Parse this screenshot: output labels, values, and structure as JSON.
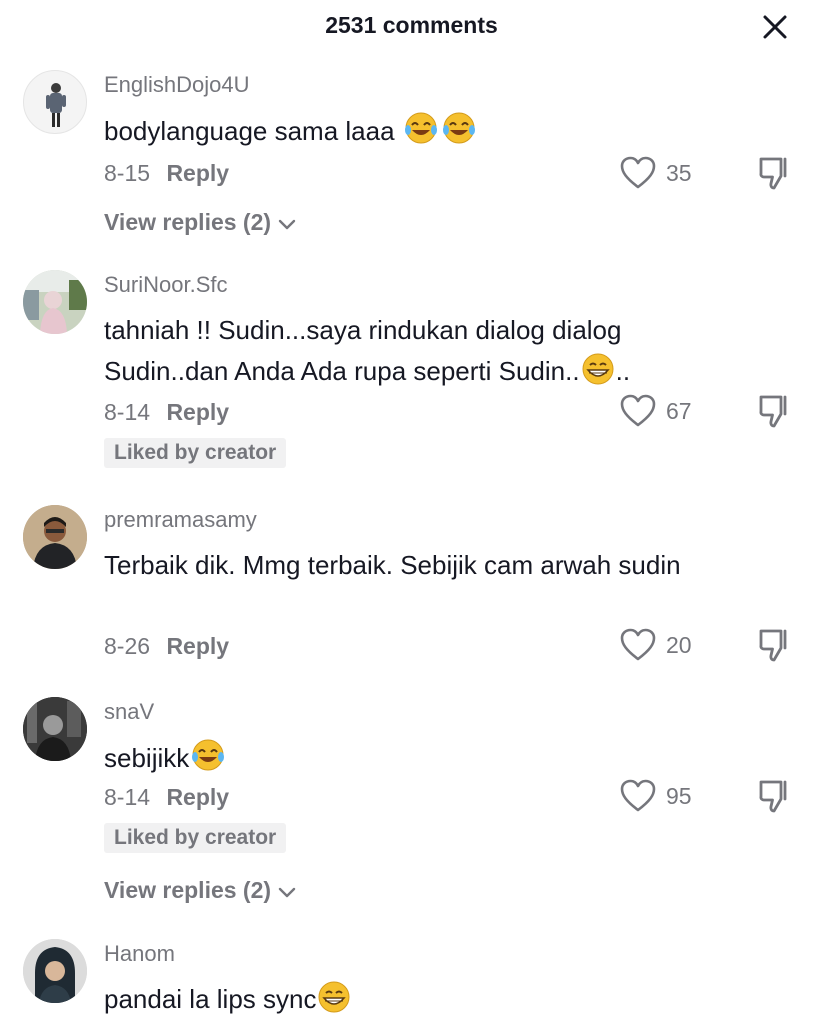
{
  "header": {
    "title": "2531 comments"
  },
  "comments": [
    {
      "username": "EnglishDojo4U",
      "text_before": "bodylanguage sama laaa ",
      "text_after": "",
      "date": "8-15",
      "reply_label": "Reply",
      "likes": "35",
      "view_replies": "View replies (2)"
    },
    {
      "username": "SuriNoor.Sfc",
      "text_before": "tahniah !! Sudin...saya rindukan dialog dialog Sudin..dan Anda Ada rupa seperti Sudin..",
      "text_after": "..",
      "date": "8-14",
      "reply_label": "Reply",
      "likes": "67",
      "badge": "Liked by creator"
    },
    {
      "username": "premramasamy",
      "text_before": "Terbaik dik. Mmg terbaik. Sebijik cam arwah sudin",
      "text_after": "",
      "date": "8-26",
      "reply_label": "Reply",
      "likes": "20"
    },
    {
      "username": "snaV",
      "text_before": "sebijikk",
      "text_after": "",
      "date": "8-14",
      "reply_label": "Reply",
      "likes": "95",
      "badge": "Liked by creator",
      "view_replies": "View replies (2)"
    },
    {
      "username": "Hanom",
      "text_before": "pandai la lips sync",
      "text_after": "",
      "date": "",
      "reply_label": "",
      "likes": ""
    }
  ],
  "colors": {
    "primary_text": "#161823",
    "secondary_text": "#75767c",
    "badge_bg": "#f1f1f2",
    "emoji_yellow": "#f5c02e"
  },
  "icons": {
    "close": "close-icon",
    "like": "heart-icon",
    "dislike": "thumbs-down-icon",
    "expand": "chevron-down-icon",
    "emoji_laugh": "tears-of-joy-emoji",
    "emoji_grin": "grinning-emoji"
  }
}
